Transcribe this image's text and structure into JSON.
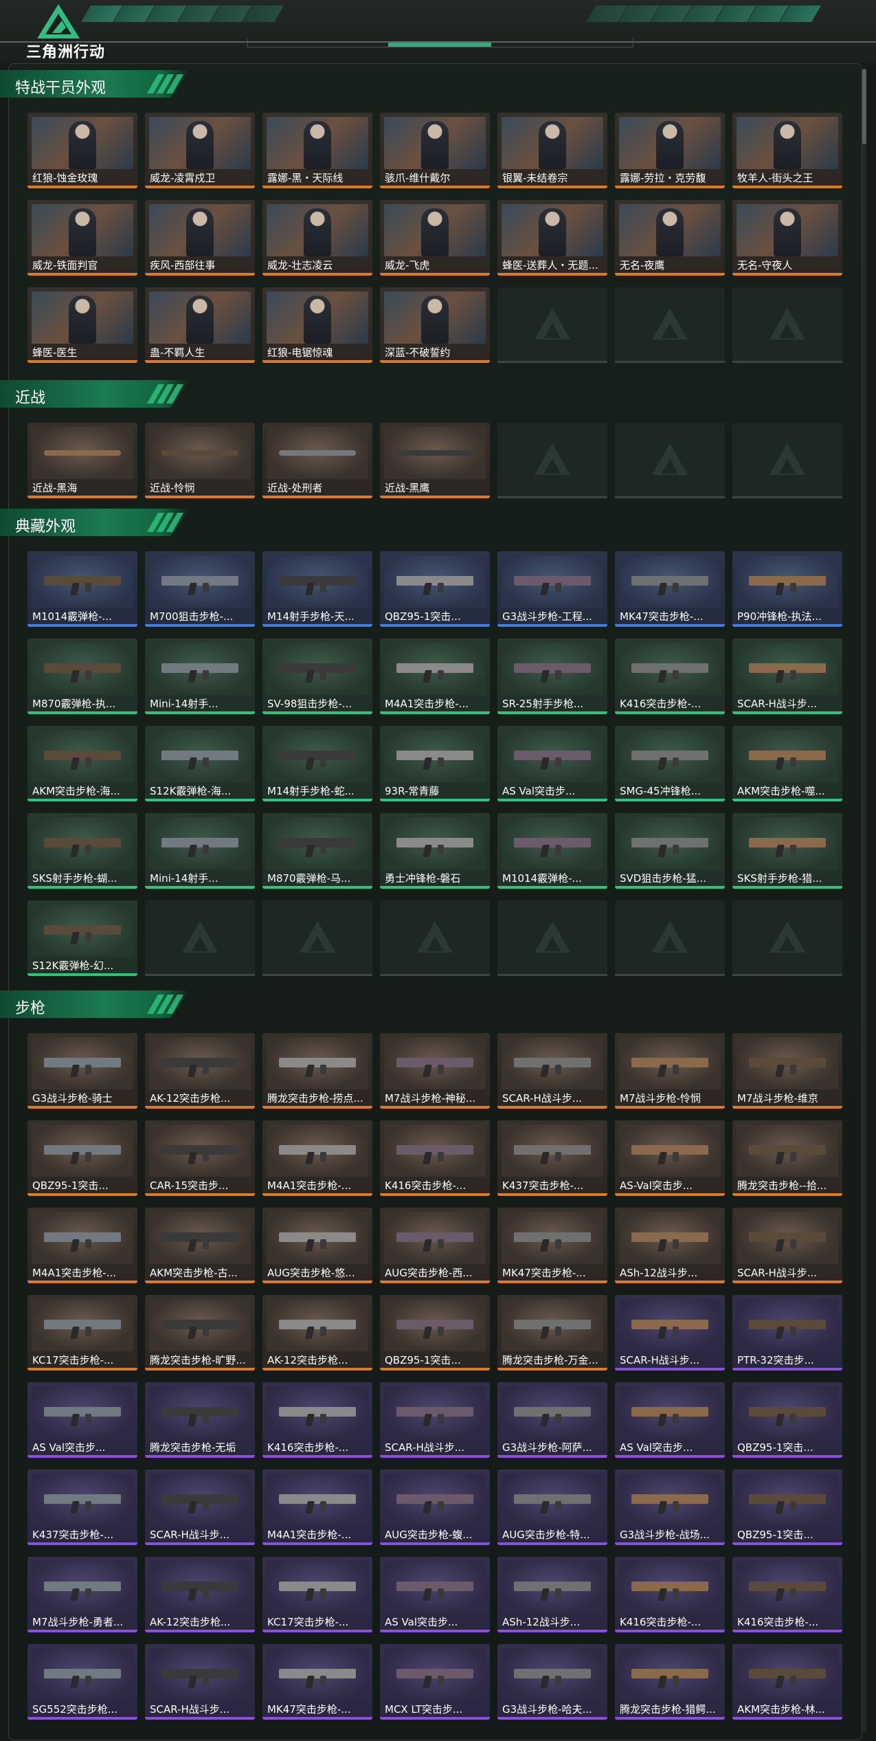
{
  "app": {
    "title": "三角洲行动"
  },
  "colors": {
    "rarity_orange": "#e07a20",
    "rarity_blue": "#3d7ee8",
    "rarity_green": "#2ec47e",
    "rarity_purple": "#8b4fe0",
    "accent": "#1b7a52"
  },
  "sections": [
    {
      "title": "特战干员外观",
      "kind": "operator",
      "empty_slots": 3,
      "items": [
        {
          "label": "红狼-蚀金玫瑰",
          "rarity": "rd"
        },
        {
          "label": "威龙-凌霄戍卫",
          "rarity": "rd"
        },
        {
          "label": "露娜-黑・天际线",
          "rarity": "rd"
        },
        {
          "label": "骇爪-维什戴尔",
          "rarity": "rd"
        },
        {
          "label": "银翼-未结卷宗",
          "rarity": "rd"
        },
        {
          "label": "露娜-劳拉・克劳馥",
          "rarity": "rd"
        },
        {
          "label": "牧羊人-街头之王",
          "rarity": "rd"
        },
        {
          "label": "威龙-铁面判官",
          "rarity": "rd"
        },
        {
          "label": "疾风-西部往事",
          "rarity": "rd"
        },
        {
          "label": "威龙-壮志凌云",
          "rarity": "rd"
        },
        {
          "label": "威龙-飞虎",
          "rarity": "rd"
        },
        {
          "label": "蜂医-送葬人・无题...",
          "rarity": "rd"
        },
        {
          "label": "无名-夜鹰",
          "rarity": "rd"
        },
        {
          "label": "无名-守夜人",
          "rarity": "rd"
        },
        {
          "label": "蜂医-医生",
          "rarity": "rd"
        },
        {
          "label": "蛊-不羁人生",
          "rarity": "rd"
        },
        {
          "label": "红狼-电锯惊魂",
          "rarity": "rd"
        },
        {
          "label": "深蓝-不破誓约",
          "rarity": "rd"
        }
      ]
    },
    {
      "title": "近战",
      "kind": "melee",
      "empty_slots": 3,
      "items": [
        {
          "label": "近战-黑海",
          "rarity": "rd"
        },
        {
          "label": "近战-怜悯",
          "rarity": "rd"
        },
        {
          "label": "近战-处刑者",
          "rarity": "rd"
        },
        {
          "label": "近战-黑鹰",
          "rarity": "rd"
        }
      ]
    },
    {
      "title": "典藏外观",
      "kind": "gun",
      "empty_slots": 6,
      "items": [
        {
          "label": "M1014霰弹枪-...",
          "rarity": "bl"
        },
        {
          "label": "M700狙击步枪-...",
          "rarity": "bl"
        },
        {
          "label": "M14射手步枪-天...",
          "rarity": "bl"
        },
        {
          "label": "QBZ95-1突击...",
          "rarity": "bl"
        },
        {
          "label": "G3战斗步枪-工程...",
          "rarity": "bl"
        },
        {
          "label": "MK47突击步枪-...",
          "rarity": "bl"
        },
        {
          "label": "P90冲锋枪-执法...",
          "rarity": "bl"
        },
        {
          "label": "M870霰弹枪-执...",
          "rarity": "gr"
        },
        {
          "label": "Mini-14射手...",
          "rarity": "gr"
        },
        {
          "label": "SV-98狙击步枪-...",
          "rarity": "gr"
        },
        {
          "label": "M4A1突击步枪-...",
          "rarity": "gr"
        },
        {
          "label": "SR-25射手步枪...",
          "rarity": "gr"
        },
        {
          "label": "K416突击步枪-...",
          "rarity": "gr"
        },
        {
          "label": "SCAR-H战斗步...",
          "rarity": "gr"
        },
        {
          "label": "AKM突击步枪-海...",
          "rarity": "gr"
        },
        {
          "label": "S12K霰弹枪-海...",
          "rarity": "gr"
        },
        {
          "label": "M14射手步枪-蛇...",
          "rarity": "gr"
        },
        {
          "label": "93R-常青藤",
          "rarity": "gr"
        },
        {
          "label": "AS Val突击步...",
          "rarity": "gr"
        },
        {
          "label": "SMG-45冲锋枪...",
          "rarity": "gr"
        },
        {
          "label": "AKM突击步枪-噬...",
          "rarity": "gr"
        },
        {
          "label": "SKS射手步枪-蝴...",
          "rarity": "gr"
        },
        {
          "label": "Mini-14射手...",
          "rarity": "gr"
        },
        {
          "label": "M870霰弹枪-马...",
          "rarity": "gr"
        },
        {
          "label": "勇士冲锋枪-磐石",
          "rarity": "gr"
        },
        {
          "label": "M1014霰弹枪-...",
          "rarity": "gr"
        },
        {
          "label": "SVD狙击步枪-猛...",
          "rarity": "gr"
        },
        {
          "label": "SKS射手步枪-猎...",
          "rarity": "gr"
        },
        {
          "label": "S12K霰弹枪-幻...",
          "rarity": "gr"
        }
      ]
    },
    {
      "title": "步枪",
      "kind": "gun",
      "empty_slots": 0,
      "items": [
        {
          "label": "G3战斗步枪-骑士",
          "rarity": "rd"
        },
        {
          "label": "AK-12突击步枪...",
          "rarity": "rd"
        },
        {
          "label": "腾龙突击步枪-捞点...",
          "rarity": "rd"
        },
        {
          "label": "M7战斗步枪-神秘...",
          "rarity": "rd"
        },
        {
          "label": "SCAR-H战斗步...",
          "rarity": "rd"
        },
        {
          "label": "M7战斗步枪-怜悯",
          "rarity": "rd"
        },
        {
          "label": "M7战斗步枪-维京",
          "rarity": "rd"
        },
        {
          "label": "QBZ95-1突击...",
          "rarity": "rd"
        },
        {
          "label": "CAR-15突击步...",
          "rarity": "rd"
        },
        {
          "label": "M4A1突击步枪-...",
          "rarity": "rd"
        },
        {
          "label": "K416突击步枪-...",
          "rarity": "rd"
        },
        {
          "label": "K437突击步枪-...",
          "rarity": "rd"
        },
        {
          "label": "AS-Val突击步...",
          "rarity": "rd"
        },
        {
          "label": "腾龙突击步枪--拾...",
          "rarity": "rd"
        },
        {
          "label": "M4A1突击步枪-...",
          "rarity": "rd"
        },
        {
          "label": "AKM突击步枪-古...",
          "rarity": "rd"
        },
        {
          "label": "AUG突击步枪-悠...",
          "rarity": "rd"
        },
        {
          "label": "AUG突击步枪-西...",
          "rarity": "rd"
        },
        {
          "label": "MK47突击步枪-...",
          "rarity": "rd"
        },
        {
          "label": "ASh-12战斗步...",
          "rarity": "rd"
        },
        {
          "label": "SCAR-H战斗步...",
          "rarity": "rd"
        },
        {
          "label": "KC17突击步枪-...",
          "rarity": "rd"
        },
        {
          "label": "腾龙突击步枪-旷野...",
          "rarity": "rd"
        },
        {
          "label": "AK-12突击步枪...",
          "rarity": "rd"
        },
        {
          "label": "QBZ95-1突击...",
          "rarity": "rd"
        },
        {
          "label": "腾龙突击步枪-万金...",
          "rarity": "rd"
        },
        {
          "label": "SCAR-H战斗步...",
          "rarity": "pu"
        },
        {
          "label": "PTR-32突击步...",
          "rarity": "pu"
        },
        {
          "label": "AS Val突击步...",
          "rarity": "pu"
        },
        {
          "label": "腾龙突击步枪-无垢",
          "rarity": "pu"
        },
        {
          "label": "K416突击步枪-...",
          "rarity": "pu"
        },
        {
          "label": "SCAR-H战斗步...",
          "rarity": "pu"
        },
        {
          "label": "G3战斗步枪-阿萨...",
          "rarity": "pu"
        },
        {
          "label": "AS Val突击步...",
          "rarity": "pu"
        },
        {
          "label": "QBZ95-1突击...",
          "rarity": "pu"
        },
        {
          "label": "K437突击步枪-...",
          "rarity": "pu"
        },
        {
          "label": "SCAR-H战斗步...",
          "rarity": "pu"
        },
        {
          "label": "M4A1突击步枪-...",
          "rarity": "pu"
        },
        {
          "label": "AUG突击步枪-蝮...",
          "rarity": "pu"
        },
        {
          "label": "AUG突击步枪-特...",
          "rarity": "pu"
        },
        {
          "label": "G3战斗步枪-战场...",
          "rarity": "pu"
        },
        {
          "label": "QBZ95-1突击...",
          "rarity": "pu"
        },
        {
          "label": "M7战斗步枪-勇者...",
          "rarity": "pu"
        },
        {
          "label": "AK-12突击步枪...",
          "rarity": "pu"
        },
        {
          "label": "KC17突击步枪-...",
          "rarity": "pu"
        },
        {
          "label": "AS Val突击步...",
          "rarity": "pu"
        },
        {
          "label": "ASh-12战斗步...",
          "rarity": "pu"
        },
        {
          "label": "K416突击步枪-...",
          "rarity": "pu"
        },
        {
          "label": "K416突击步枪-...",
          "rarity": "pu"
        },
        {
          "label": "SG552突击步枪...",
          "rarity": "pu"
        },
        {
          "label": "SCAR-H战斗步...",
          "rarity": "pu"
        },
        {
          "label": "MK47突击步枪-...",
          "rarity": "pu"
        },
        {
          "label": "MCX LT突击步...",
          "rarity": "pu"
        },
        {
          "label": "G3战斗步枪-哈夫...",
          "rarity": "pu"
        },
        {
          "label": "腾龙突击步枪-猎鳄...",
          "rarity": "pu"
        },
        {
          "label": "AKM突击步枪-林...",
          "rarity": "pu"
        }
      ]
    }
  ]
}
